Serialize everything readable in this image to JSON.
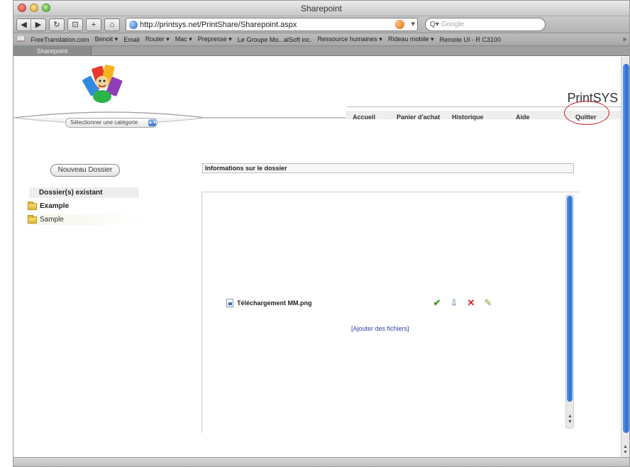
{
  "browser": {
    "window_title": "Sharepoint",
    "url": "http://printsys.net/PrintShare/Sharepoint.aspx",
    "search_placeholder": "Google",
    "bookmarks": [
      "FreeTranslation.com",
      "Benoit ▾",
      "Email",
      "Router ▾",
      "Mac ▾",
      "Prepresse ▾",
      "Le Groupe Mo...alSoft inc.",
      "Ressource humaines ▾",
      "Rideau mobile ▾",
      "Remote UI - R C3100"
    ],
    "active_tab": "Sharepoint"
  },
  "header": {
    "brand": "PrintSYS",
    "category_select": "Sélectionner une catégorie",
    "menu": [
      "Accueil",
      "Panier d'achat",
      "Historique",
      "Aide",
      "Quitter"
    ]
  },
  "sidebar": {
    "new_folder_button": "Nouveau Dossier",
    "folders_heading": "Dossier(s) existant",
    "folders": [
      "Example",
      "Sample"
    ]
  },
  "main": {
    "info_title": "Informations sur le dossier",
    "file_name": "Téléchargement MM.png",
    "add_files": "[Ajouter des fichiers]"
  },
  "colors": {
    "accent_blue": "#2a6cd3",
    "highlight_red": "#c8202a",
    "folder_yellow": "#e1b735"
  },
  "icons": {
    "approve": "check-icon",
    "download": "download-icon",
    "delete": "delete-icon",
    "edit": "edit-icon"
  }
}
